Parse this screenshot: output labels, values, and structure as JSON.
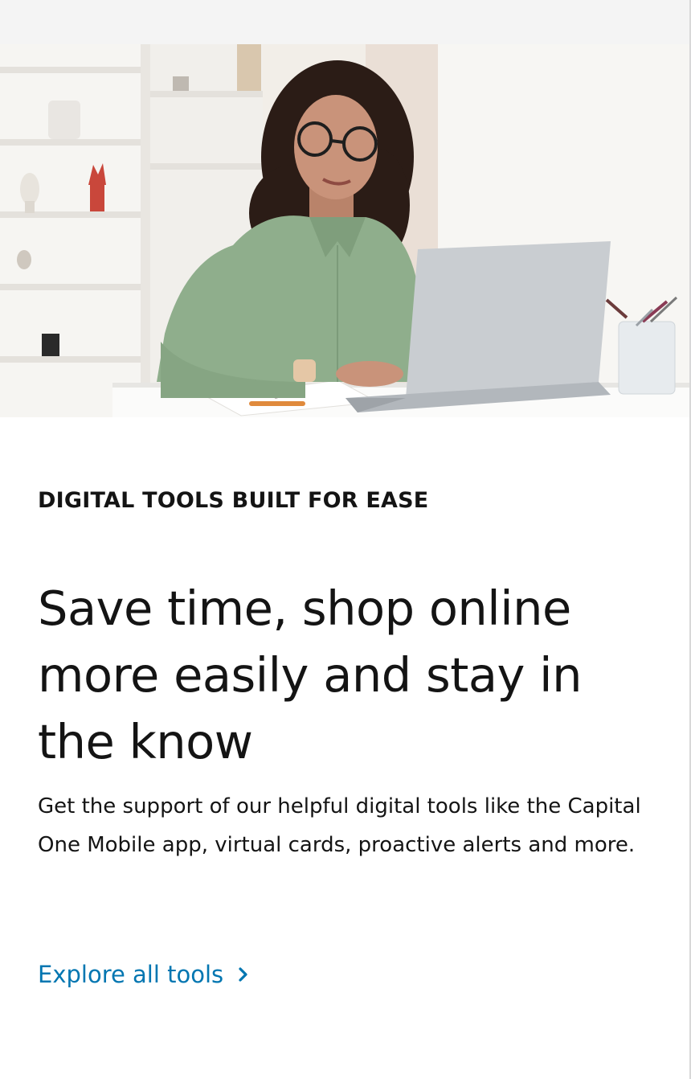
{
  "hero": {
    "image_description_name": "woman-working-on-laptop-image"
  },
  "section": {
    "eyebrow": "DIGITAL TOOLS BUILT FOR EASE",
    "headline": "Save time, shop online more easily and stay in the know",
    "body": "Get the support of our helpful digital tools like the Capital One Mobile app, virtual cards, proactive alerts and more.",
    "cta_label": "Explore all tools",
    "cta_icon": "chevron-right-icon"
  },
  "colors": {
    "link": "#0276b1",
    "text": "#141414",
    "background": "#ffffff"
  }
}
